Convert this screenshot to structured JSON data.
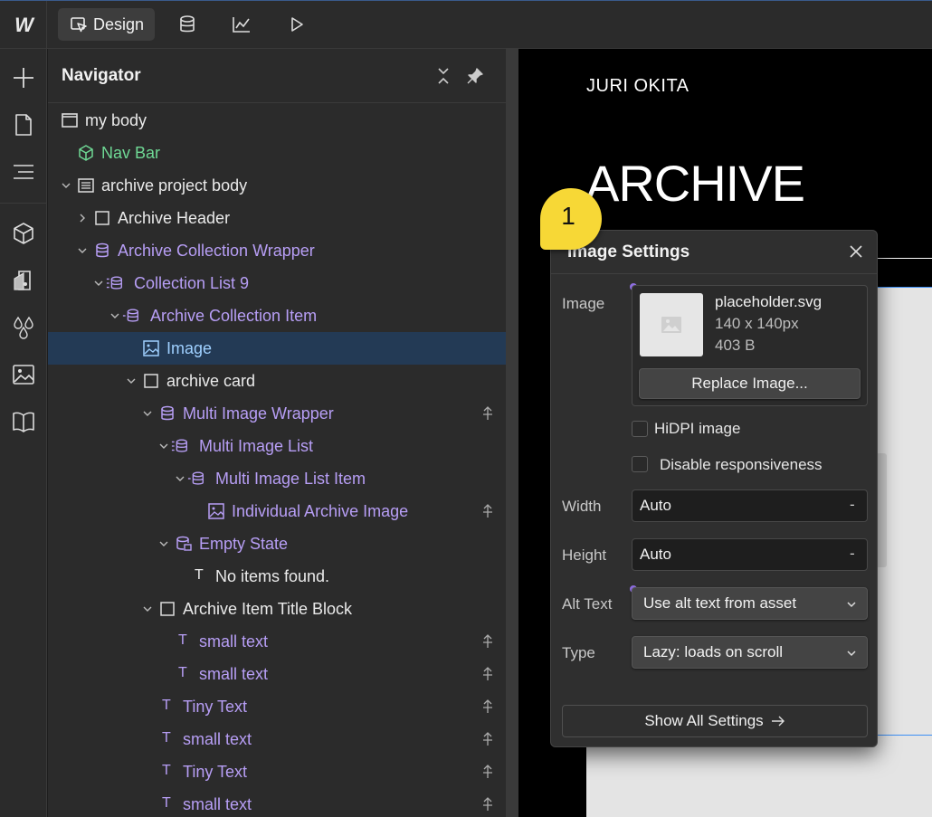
{
  "topbar": {
    "logo": "W",
    "design_tab_label": "Design"
  },
  "navigator": {
    "title": "Navigator",
    "items": [
      {
        "label": "my body",
        "color": "white",
        "icon": "body-icon"
      },
      {
        "label": "Nav Bar",
        "color": "green",
        "icon": "component-icon"
      },
      {
        "label": "archive project body",
        "color": "white",
        "icon": "section-icon"
      },
      {
        "label": "Archive Header",
        "color": "white",
        "icon": "div-block-icon"
      },
      {
        "label": "Archive Collection Wrapper",
        "color": "purple",
        "icon": "collection-wrapper-icon"
      },
      {
        "label": "Collection List 9",
        "color": "purple",
        "icon": "collection-list-icon"
      },
      {
        "label": "Archive Collection Item",
        "color": "purple",
        "icon": "collection-item-icon"
      },
      {
        "label": "Image",
        "color": "blue",
        "icon": "image-icon"
      },
      {
        "label": "archive card",
        "color": "white",
        "icon": "div-block-icon"
      },
      {
        "label": "Multi Image Wrapper",
        "color": "purple",
        "icon": "collection-wrapper-icon"
      },
      {
        "label": "Multi Image List",
        "color": "purple",
        "icon": "collection-list-icon"
      },
      {
        "label": "Multi Image List Item",
        "color": "purple",
        "icon": "collection-item-icon"
      },
      {
        "label": "Individual Archive Image",
        "color": "purple",
        "icon": "image-icon"
      },
      {
        "label": "Empty State",
        "color": "purple",
        "icon": "empty-state-icon"
      },
      {
        "label": "No items found.",
        "color": "white",
        "icon": "text-icon"
      },
      {
        "label": "Archive Item Title Block",
        "color": "white",
        "icon": "div-block-icon"
      },
      {
        "label": "small text",
        "color": "purple",
        "icon": "text-icon"
      },
      {
        "label": "small text",
        "color": "purple",
        "icon": "text-icon"
      },
      {
        "label": "Tiny Text",
        "color": "purple",
        "icon": "text-icon"
      },
      {
        "label": "small text",
        "color": "purple",
        "icon": "text-icon"
      },
      {
        "label": "Tiny Text",
        "color": "purple",
        "icon": "text-icon"
      },
      {
        "label": "small text",
        "color": "purple",
        "icon": "text-icon"
      }
    ]
  },
  "canvas": {
    "site_name": "JURI OKITA",
    "heading": "ARCHIVE"
  },
  "image_settings": {
    "title": "Image Settings",
    "image_label": "Image",
    "file_name": "placeholder.svg",
    "file_dims": "140 x 140px",
    "file_size": "403 B",
    "replace_button": "Replace Image...",
    "hidpi_label": "HiDPI image",
    "hidpi_checked": false,
    "disable_resp_label": "Disable responsiveness",
    "disable_resp_checked": false,
    "width_label": "Width",
    "width_value": "Auto",
    "width_unit": "-",
    "height_label": "Height",
    "height_value": "Auto",
    "height_unit": "-",
    "alt_label": "Alt Text",
    "alt_value": "Use alt text from asset",
    "type_label": "Type",
    "type_value": "Lazy: loads on scroll",
    "show_all_button": "Show All Settings"
  },
  "callout": {
    "number": "1",
    "color": "#f7d836"
  },
  "colors": {
    "selected_row": "#233a55",
    "purple": "#b79ef5",
    "green": "#6fd995",
    "accent_blue": "#3d8ff5"
  }
}
